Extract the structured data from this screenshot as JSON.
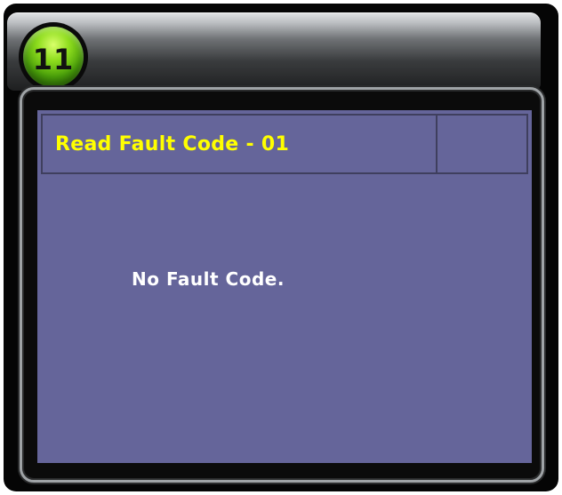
{
  "badge": {
    "step_number": "11"
  },
  "screen": {
    "title": "Read Fault Code - 01",
    "message": "No Fault Code."
  },
  "colors": {
    "screen_background": "#65659a",
    "title_text": "#ffff00",
    "message_text": "#ffffff",
    "badge": "#8fdd1e"
  }
}
